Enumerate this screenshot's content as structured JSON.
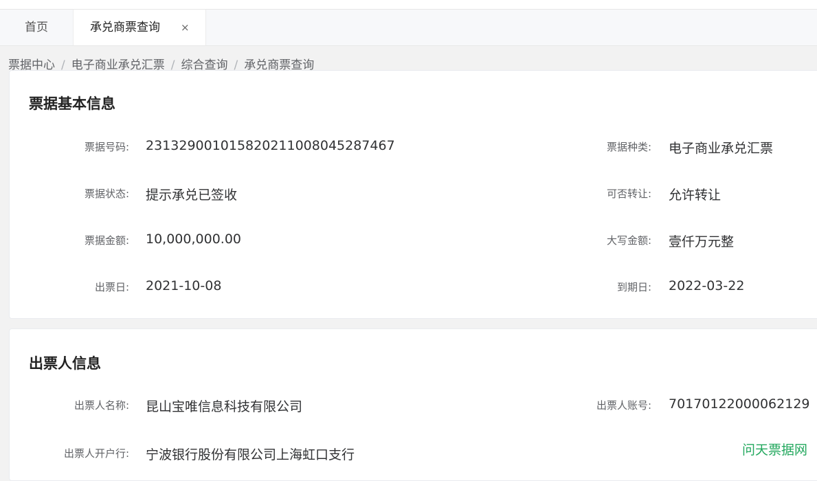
{
  "tabs": {
    "home": "首页",
    "active": "承兑商票查询",
    "close_icon": "×"
  },
  "breadcrumb": {
    "items": [
      "票据中心",
      "电子商业承兑汇票",
      "综合查询",
      "承兑商票查询"
    ],
    "separator": "/"
  },
  "basic_info": {
    "title": "票据基本信息",
    "bill_no_label": "票据号码:",
    "bill_no": "231329001015820211008045287467",
    "bill_type_label": "票据种类:",
    "bill_type": "电子商业承兑汇票",
    "status_label": "票据状态:",
    "status": "提示承兑已签收",
    "transferable_label": "可否转让:",
    "transferable": "允许转让",
    "amount_label": "票据金额:",
    "amount": "10,000,000.00",
    "amount_upper_label": "大写金额:",
    "amount_upper": "壹仟万元整",
    "issue_date_label": "出票日:",
    "issue_date": "2021-10-08",
    "due_date_label": "到期日:",
    "due_date": "2022-03-22"
  },
  "drawer_info": {
    "title": "出票人信息",
    "name_label": "出票人名称:",
    "name": "昆山宝唯信息科技有限公司",
    "account_label": "出票人账号:",
    "account": "70170122000062129",
    "bank_label": "出票人开户行:",
    "bank": "宁波银行股份有限公司上海虹口支行"
  },
  "watermark": "问天票据网"
}
